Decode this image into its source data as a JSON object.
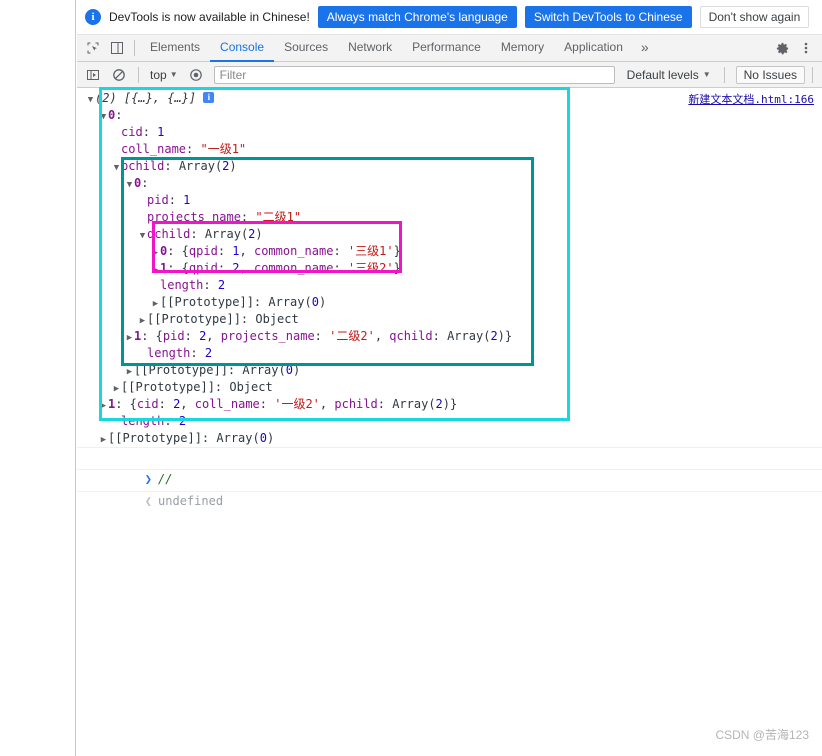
{
  "notice": {
    "icon": "info-icon",
    "message": "DevTools is now available in Chinese!",
    "primary_button": "Always match Chrome's language",
    "secondary_button": "Switch DevTools to Chinese",
    "dismiss_button": "Don't show again"
  },
  "tabstrip": {
    "inspect_icon": "inspect-element-icon",
    "device_icon": "toggle-device-toolbar-icon",
    "tabs": [
      {
        "label": "Elements",
        "active": false
      },
      {
        "label": "Console",
        "active": true
      },
      {
        "label": "Sources",
        "active": false
      },
      {
        "label": "Network",
        "active": false
      },
      {
        "label": "Performance",
        "active": false
      },
      {
        "label": "Memory",
        "active": false
      },
      {
        "label": "Application",
        "active": false
      }
    ],
    "more_tabs": "»",
    "settings_icon": "gear-icon",
    "menu_icon": "more-vertical-icon"
  },
  "console_toolbar": {
    "sidebar_icon": "console-sidebar-icon",
    "clear_icon": "clear-console-icon",
    "context_label": "top",
    "eye_icon": "live-expression-icon",
    "filter_placeholder": "Filter",
    "filter_value": "",
    "levels_label": "Default levels",
    "issues_label": "No Issues"
  },
  "console": {
    "source_link": "新建文本文档.html:166",
    "lines": [
      {
        "id": "l0",
        "indent": 0,
        "arrow": "open",
        "text": "(2) [{…}, {…}]",
        "style": "italic",
        "badge": "i"
      },
      {
        "id": "l1",
        "indent": 1,
        "arrow": "open",
        "text": "0:"
      },
      {
        "id": "l2",
        "indent": 2,
        "arrow": "none",
        "text": "cid: 1"
      },
      {
        "id": "l3",
        "indent": 2,
        "arrow": "none",
        "text": "coll_name: \"一级1\""
      },
      {
        "id": "l4",
        "indent": 2,
        "arrow": "open",
        "text": "pchild: Array(2)"
      },
      {
        "id": "l5",
        "indent": 3,
        "arrow": "open",
        "text": "0:"
      },
      {
        "id": "l6",
        "indent": 4,
        "arrow": "none",
        "text": "pid: 1"
      },
      {
        "id": "l7",
        "indent": 4,
        "arrow": "none",
        "text": "projects_name: \"二级1\""
      },
      {
        "id": "l8",
        "indent": 4,
        "arrow": "open",
        "text": "qchild: Array(2)"
      },
      {
        "id": "l9",
        "indent": 5,
        "arrow": "closed",
        "text": "0: {qpid: 1, common_name: '三级1'}"
      },
      {
        "id": "l10",
        "indent": 5,
        "arrow": "closed",
        "text": "1: {qpid: 2, common_name: '三级2'}"
      },
      {
        "id": "l11",
        "indent": 5,
        "arrow": "none",
        "text": "length: 2"
      },
      {
        "id": "l12",
        "indent": 5,
        "arrow": "closed",
        "text": "[[Prototype]]: Array(0)"
      },
      {
        "id": "l13",
        "indent": 4,
        "arrow": "closed",
        "text": "[[Prototype]]: Object"
      },
      {
        "id": "l14",
        "indent": 3,
        "arrow": "closed",
        "text": "1: {pid: 2, projects_name: '二级2', qchild: Array(2)}"
      },
      {
        "id": "l15",
        "indent": 4,
        "arrow": "none",
        "text": "length: 2"
      },
      {
        "id": "l16",
        "indent": 3,
        "arrow": "closed",
        "text": "[[Prototype]]: Array(0)"
      },
      {
        "id": "l17",
        "indent": 2,
        "arrow": "closed",
        "text": "[[Prototype]]: Object"
      },
      {
        "id": "l18",
        "indent": 1,
        "arrow": "closed",
        "text": "1: {cid: 2, coll_name: '一级2', pchild: Array(2)}"
      },
      {
        "id": "l19",
        "indent": 2,
        "arrow": "none",
        "text": "length: 2"
      },
      {
        "id": "l20",
        "indent": 1,
        "arrow": "closed",
        "text": "[[Prototype]]: Array(0)"
      }
    ],
    "prompt_input": "//",
    "prompt_result": "undefined"
  },
  "annotations": {
    "outer_color": "#1ad6de",
    "middle_color": "#009595",
    "inner_color": "#f215c8"
  },
  "watermark": "CSDN @苦海123"
}
